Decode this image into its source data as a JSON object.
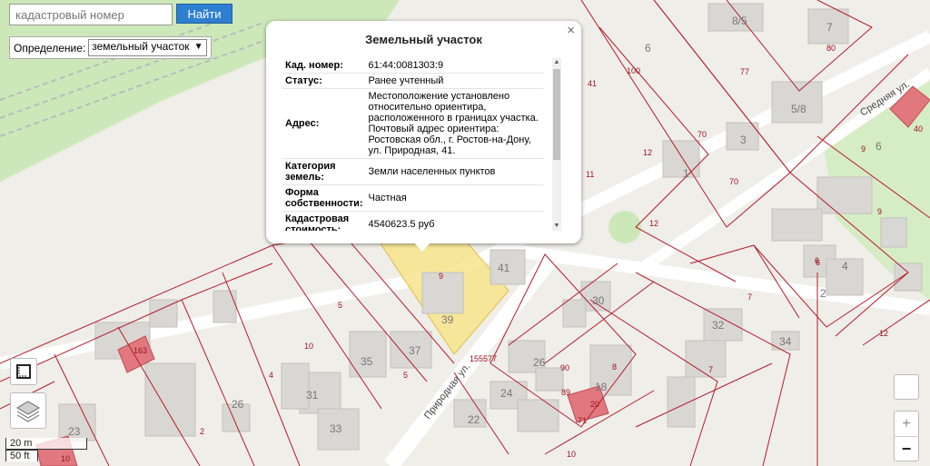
{
  "search": {
    "placeholder": "кадастровый номер",
    "button": "Найти"
  },
  "definition": {
    "label": "Определение:",
    "selected": "земельный участок"
  },
  "popup": {
    "close": "×",
    "title": "Земельный участок",
    "rows": [
      {
        "key": "Кад. номер:",
        "value": "61:44:0081303:9"
      },
      {
        "key": "Статус:",
        "value": "Ранее учтенный"
      },
      {
        "key": "Адрес:",
        "value": "Местоположение установлено относительно ориентира, расположенного в границах участка. Почтовый адрес ориентира: Ростовская обл., г. Ростов-на-Дону, ул. Природная, 41."
      },
      {
        "key": "Категория земель:",
        "value": "Земли населенных пунктов"
      },
      {
        "key": "Форма собственности:",
        "value": "Частная"
      },
      {
        "key": "Кадастровая стоимость:",
        "value": "4540623.5 руб"
      }
    ]
  },
  "map": {
    "street_labels": [
      "Природная ул.",
      "Средняя ул."
    ],
    "house_numbers": [
      "8/5",
      "7",
      "6",
      "5/8",
      "3",
      "1",
      "41",
      "39",
      "37",
      "35",
      "33",
      "31",
      "30",
      "32",
      "34",
      "26",
      "24",
      "22",
      "23",
      "26",
      "4",
      "2",
      "4",
      "6",
      "18",
      "7"
    ],
    "plot_numbers": [
      "80",
      "100",
      "77",
      "70",
      "70",
      "12",
      "11",
      "12",
      "9",
      "6",
      "40",
      "9",
      "9",
      "5",
      "10",
      "4",
      "2",
      "163",
      "155577",
      "90",
      "89",
      "8",
      "10",
      "7",
      "12",
      "6",
      "7",
      "41",
      "20",
      "71",
      "10"
    ]
  },
  "scale": {
    "metric": "20 m",
    "imperial": "50 ft"
  },
  "zoom": {
    "in": "+",
    "out": "−"
  },
  "colors": {
    "highlight": "#f7e48c",
    "boundary": "#b51c2a",
    "road": "#ffffff",
    "green": "#cde8b8",
    "building": "#d9d7d3"
  }
}
